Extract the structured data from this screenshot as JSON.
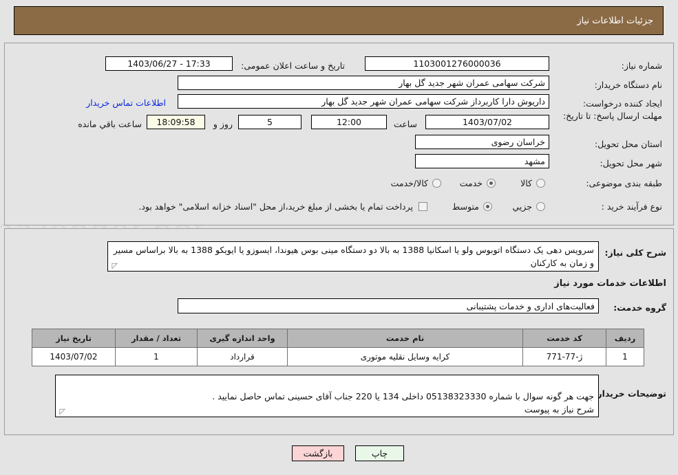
{
  "header": {
    "title": "جزئیات اطلاعات نیاز"
  },
  "top_form": {
    "need_number_label": "شماره نیاز:",
    "need_number_value": "1103001276000036",
    "announce_datetime_label": "تاریخ و ساعت اعلان عمومی:",
    "announce_datetime_value": "1403/06/27 - 17:33",
    "buyer_org_label": "نام دستگاه خریدار:",
    "buyer_org_value": "شرکت سهامی عمران شهر جدید گل بهار",
    "requester_label": "ایجاد کننده درخواست:",
    "requester_value": "داریوش دارا کاربرداز شرکت سهامی عمران شهر جدید گل بهار",
    "buyer_contact_link": "اطلاعات تماس خریدار",
    "deadline_label": "مهلت ارسال پاسخ: تا تاریخ:",
    "deadline_date": "1403/07/02",
    "hour_label": "ساعت",
    "hour_value": "12:00",
    "days_value": "5",
    "days_label": "روز و",
    "countdown_value": "18:09:58",
    "countdown_label": "ساعت باقي مانده",
    "province_label": "استان محل تحویل:",
    "province_value": "خراسان رضوی",
    "city_label": "شهر محل تحویل:",
    "city_value": "مشهد",
    "category_label": "طبقه بندی موضوعی:",
    "category_options": [
      {
        "label": "کالا",
        "selected": false
      },
      {
        "label": "خدمت",
        "selected": true
      },
      {
        "label": "کالا/خدمت",
        "selected": false
      }
    ],
    "purchase_type_label": "نوع فرآیند خرید :",
    "purchase_type_options": [
      {
        "label": "جزیي",
        "selected": false
      },
      {
        "label": "متوسط",
        "selected": true
      }
    ],
    "treasury_checkbox_label": "پرداخت تمام یا بخشی از مبلغ خرید،از محل \"اسناد خزانه اسلامی\" خواهد بود.",
    "treasury_checkbox_checked": false
  },
  "bottom_form": {
    "summary_label": "شرح کلی نیاز:",
    "summary_value": "سرویس دهی یک دستگاه اتوبوس ولو یا اسکانیا 1388 به بالا دو دستگاه مینی بوس هیوندا، ایسوزو یا ایویکو 1388 به بالا براساس مسیر و زمان به کارکنان",
    "services_heading": "اطلاعات خدمات مورد نیاز",
    "service_group_label": "گروه خدمت:",
    "service_group_value": "فعالیت‌های اداری و خدمات پشتیبانی",
    "table": {
      "columns": [
        "ردیف",
        "کد خدمت",
        "نام خدمت",
        "واحد اندازه گیری",
        "تعداد / مقدار",
        "تاریخ نیاز"
      ],
      "rows": [
        {
          "row_no": "1",
          "service_code": "ژ-77-771",
          "service_name": "کرایه وسایل نقلیه موتوری",
          "unit": "قرارداد",
          "quantity": "1",
          "need_date": "1403/07/02"
        }
      ]
    },
    "buyer_notes_label": "توضیحات خریدار:",
    "buyer_notes_value": "جهت هر گونه سوال با شماره 05138323330 داخلی 134 یا 220 جناب آقای حسینی تماس حاصل نمایید .\nشرح نیاز به پیوست"
  },
  "footer": {
    "print_button": "چاپ",
    "back_button": "بازگشت"
  },
  "watermark": {
    "text": "AnaTender.net"
  },
  "colors": {
    "header_bg": "#8b6b46",
    "link": "#0a28e0",
    "print_btn": "#e8f7e8",
    "back_btn": "#fbd5d5",
    "countdown_bg": "#fbfbe8",
    "table_header_bg": "#b7b7b7"
  }
}
